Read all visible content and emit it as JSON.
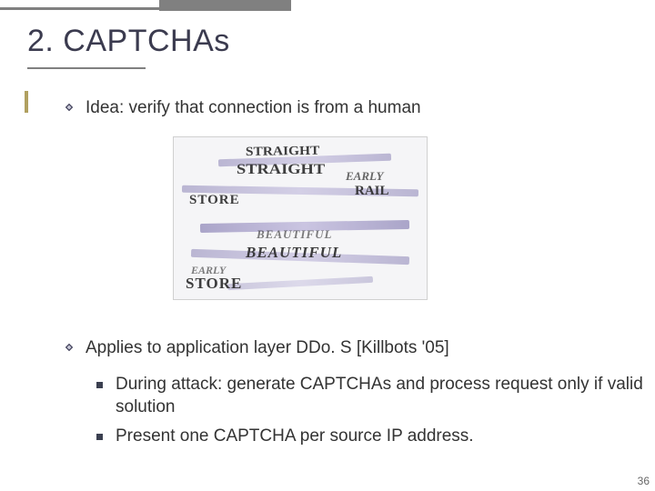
{
  "title": "2.  CAPTCHAs",
  "bullets": {
    "idea": "Idea:   verify that connection is from a human",
    "applies": "Applies to application layer DDo. S    [Killbots '05]",
    "sub1": "During attack: generate CAPTCHAs and process request only if valid solution",
    "sub2": "Present one CAPTCHA per source IP address."
  },
  "captcha_words": {
    "w1": "STRAIGHT",
    "w2": "STRAIGHT",
    "w3": "EARLY",
    "w4": "RAIL",
    "w5": "STORE",
    "w6": "BEAUTIFUL",
    "w7": "BEAUTIFUL",
    "w8": "EARLY",
    "w9": "STORE"
  },
  "slide_number": "36"
}
